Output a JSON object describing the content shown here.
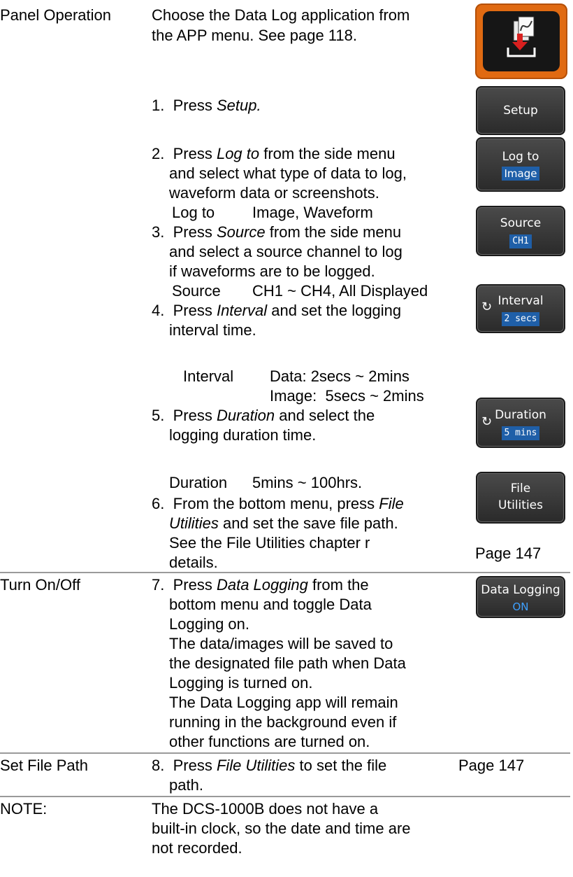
{
  "sections": {
    "panel_operation": "Panel Operation",
    "turn_on_off": "Turn On/Off",
    "set_file_path": "Set File Path",
    "note": "NOTE:"
  },
  "intro": {
    "line1": "Choose the Data Log application from",
    "line2": "the APP menu. See page 118."
  },
  "steps": {
    "s1": {
      "num": "1.",
      "pre": "Press ",
      "em": "Setup.",
      "post": ""
    },
    "s2": {
      "num": "2.",
      "pre": "Press ",
      "em": "Log to",
      "post": " from the side menu",
      "line2": "and select what type of data to log,",
      "line3": "waveform data or screenshots.",
      "param_name": "Log to",
      "param_value": "Image, Waveform"
    },
    "s3": {
      "num": "3.",
      "pre": "Press ",
      "em": "Source",
      "post": " from the side menu",
      "line2": "and select a source channel to log",
      "line3": "if waveforms are to be logged.",
      "param_name": "Source",
      "param_value": "CH1 ~ CH4, All Displayed"
    },
    "s4": {
      "num": "4.",
      "pre": "Press ",
      "em": "Interval",
      "post": " and set the logging",
      "line2": "interval time.",
      "param_name": "Interval",
      "param_value1": "Data: 2secs ~ 2mins",
      "param_value2": "Image:  5secs ~ 2mins"
    },
    "s5": {
      "num": "5.",
      "pre": "Press ",
      "em": "Duration",
      "post": " and select the",
      "line2": "logging duration time.",
      "param_name": "Duration",
      "param_value": "5mins ~ 100hrs."
    },
    "s6": {
      "num": "6.",
      "pre": "From the bottom menu, press ",
      "em": "File",
      "line2_em": "Utilities",
      "line2_post": " and set the save file path.",
      "line3": "See the File Utilities chapter r",
      "line4": "details."
    },
    "s7": {
      "num": "7.",
      "pre": "Press ",
      "em": "Data Logging",
      "post": " from the",
      "line2": "bottom menu and toggle Data",
      "line3": "Logging on.",
      "line4": "The data/images will be saved to",
      "line5": "the designated file path when Data",
      "line6": "Logging is turned on.",
      "line7": "The Data Logging app will remain",
      "line8": "running in the background even if",
      "line9": "other functions are turned on."
    },
    "s8": {
      "num": "8.",
      "pre": "Press ",
      "em": "File Utilities",
      "post": " to set the file",
      "line2": "path."
    }
  },
  "note": {
    "line1": "The DCS-1000B does not have a",
    "line2": "built-in clock, so the date and time are",
    "line3": "not recorded."
  },
  "buttons": {
    "setup": "Setup",
    "log_to": {
      "label": "Log to",
      "value": "Image"
    },
    "source": {
      "label": "Source",
      "value": "CH1"
    },
    "interval": {
      "label": "Interval",
      "value": "2 secs"
    },
    "duration": {
      "label": "Duration",
      "value": "5 mins"
    },
    "file_utilities": {
      "line1": "File",
      "line2": "Utilities"
    },
    "data_logging": {
      "label": "Data Logging",
      "value": "ON"
    }
  },
  "page_refs": {
    "file_utilities": "Page 147",
    "set_file_path": "Page 147"
  },
  "colors": {
    "app_icon_orange": "#e06a12",
    "button_value_blue": "#1f5fa8",
    "icon_arrow_red": "#d9201f"
  }
}
